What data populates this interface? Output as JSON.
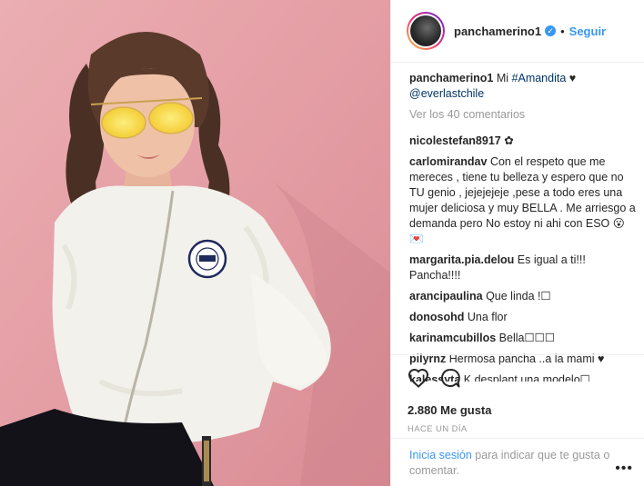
{
  "post": {
    "username": "panchamerino1",
    "follow_label": "Seguir",
    "separator": "•",
    "verified_glyph": "✓"
  },
  "caption": {
    "username": "panchamerino1",
    "text": " Mi ",
    "hashtag": "#Amandita",
    "heart": " ♥",
    "mention": "@everlastchile"
  },
  "view_comments": "Ver los 40 comentarios",
  "comments": [
    {
      "user": "nicolestefan8917",
      "text": " ✿"
    },
    {
      "user": "carlomirandav",
      "text": " Con el respeto que me mereces , tiene tu belleza y espero que no TU genio , jejejejeje ,pese a todo eres una mujer deliciosa y muy BELLA . Me arriesgo a demanda pero No estoy ni ahi con ESO 😮💌"
    },
    {
      "user": "margarita.pia.delou",
      "text": " Es igual a ti!!! Pancha!!!!"
    },
    {
      "user": "arancipaulina",
      "text": " Que linda !☐"
    },
    {
      "user": "donosohd",
      "text": " Una flor"
    },
    {
      "user": "karinamcubillos",
      "text": " Bella☐☐☐"
    },
    {
      "user": "pilyrnz",
      "text": " Hermosa pancha ..a la mami ♥"
    },
    {
      "user": "kalessyta",
      "text": " K desplant una modelo☐"
    }
  ],
  "likes": "2.880 Me gusta",
  "timestamp": "HACE UN DÍA",
  "footer": {
    "login_label": "Inicia sesión",
    "rest": " para indicar que te gusta o comentar.",
    "more_label": "•••"
  },
  "colors": {
    "accent": "#3897f0",
    "photo_bg": "#e49aa1"
  },
  "icons": [
    "heart-icon",
    "comment-icon",
    "more-options-icon",
    "verified-icon"
  ]
}
